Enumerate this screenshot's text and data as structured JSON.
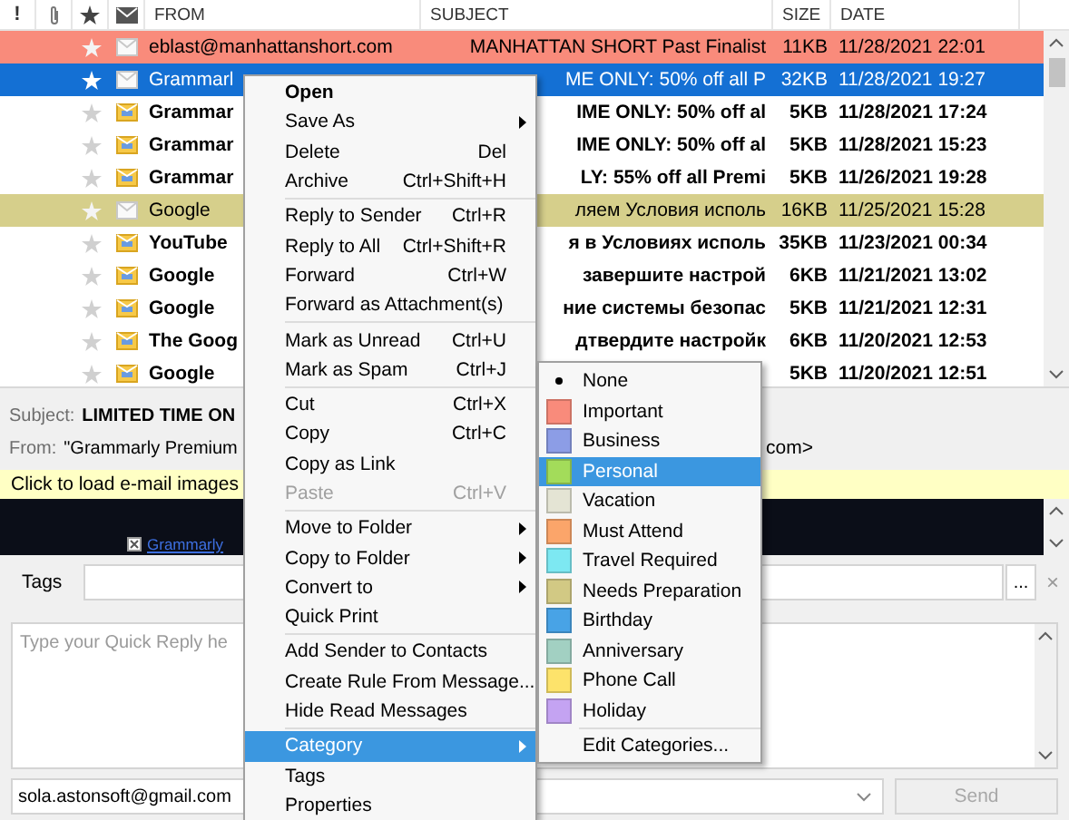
{
  "mail_list": {
    "priority_label": "!",
    "columns": [
      "FROM",
      "SUBJECT",
      "SIZE",
      "DATE"
    ],
    "rows": [
      {
        "from": "eblast@manhattanshort.com",
        "subject": "MANHATTAN SHORT Past Finalist",
        "size": "11KB",
        "date": "11/28/2021 22:01",
        "unread": false,
        "selected": false,
        "color": "#f98b7b"
      },
      {
        "from": "Grammarl",
        "subject": "ME ONLY: 50% off all P",
        "size": "32KB",
        "date": "11/28/2021 19:27",
        "unread": false,
        "selected": true
      },
      {
        "from": "Grammar",
        "subject": "IME ONLY: 50% off al",
        "size": "5KB",
        "date": "11/28/2021 17:24",
        "unread": true,
        "selected": false
      },
      {
        "from": "Grammar",
        "subject": "IME ONLY: 50% off al",
        "size": "5KB",
        "date": "11/28/2021 15:23",
        "unread": true,
        "selected": false
      },
      {
        "from": "Grammar",
        "subject": "LY: 55% off all Premi",
        "size": "5KB",
        "date": "11/26/2021 19:28",
        "unread": true,
        "selected": false
      },
      {
        "from": "Google",
        "subject": "ляем Условия исполь",
        "size": "16KB",
        "date": "11/25/2021 15:28",
        "unread": false,
        "selected": false,
        "color": "#d6cf8b"
      },
      {
        "from": "YouTube",
        "subject": "я в Условиях исполь",
        "size": "35KB",
        "date": "11/23/2021 00:34",
        "unread": true,
        "selected": false
      },
      {
        "from": "Google",
        "subject": "завершите настрой",
        "size": "6KB",
        "date": "11/21/2021 13:02",
        "unread": true,
        "selected": false
      },
      {
        "from": "Google",
        "subject": "ние системы безопас",
        "size": "5KB",
        "date": "11/21/2021 12:31",
        "unread": true,
        "selected": false
      },
      {
        "from": "The Goog",
        "subject": "дтвердите настройк",
        "size": "6KB",
        "date": "11/20/2021 12:53",
        "unread": true,
        "selected": false
      },
      {
        "from": "Google",
        "size": "5KB",
        "date": "11/20/2021 12:51",
        "unread": true,
        "selected": false
      }
    ]
  },
  "preview": {
    "subject_label": "Subject:",
    "subject": "LIMITED TIME ON",
    "from_label": "From:",
    "from": "\"Grammarly Premium",
    "from_end": "com>",
    "notice": "Click to load e-mail images",
    "image_link": "Grammarly",
    "tags_label": "Tags",
    "tags_button": "...",
    "tags_clear": "×",
    "quick_reply_placeholder": "Type your Quick Reply he",
    "account": "sola.astonsoft@gmail.com",
    "send": {
      "label": "Send",
      "disabled": true
    }
  },
  "context_menu": {
    "items": [
      {
        "kind": "item",
        "label": "Open",
        "default": true,
        "submenu": false,
        "disabled": false,
        "selected": false
      },
      {
        "kind": "item",
        "label": "Save As",
        "default": false,
        "submenu": true,
        "disabled": false,
        "selected": false
      },
      {
        "kind": "item",
        "label": "Delete",
        "shortcut": "Del",
        "default": false,
        "submenu": false,
        "disabled": false,
        "selected": false
      },
      {
        "kind": "item",
        "label": "Archive",
        "shortcut": "Ctrl+Shift+H",
        "default": false,
        "submenu": false,
        "disabled": false,
        "selected": false
      },
      {
        "kind": "separator"
      },
      {
        "kind": "item",
        "label": "Reply to Sender",
        "shortcut": "Ctrl+R",
        "default": false,
        "submenu": false,
        "disabled": false,
        "selected": false
      },
      {
        "kind": "item",
        "label": "Reply to All",
        "shortcut": "Ctrl+Shift+R",
        "default": false,
        "submenu": false,
        "disabled": false,
        "selected": false
      },
      {
        "kind": "item",
        "label": "Forward",
        "shortcut": "Ctrl+W",
        "default": false,
        "submenu": false,
        "disabled": false,
        "selected": false
      },
      {
        "kind": "item",
        "label": "Forward as Attachment(s)",
        "default": false,
        "submenu": false,
        "disabled": false,
        "selected": false
      },
      {
        "kind": "separator"
      },
      {
        "kind": "item",
        "label": "Mark as Unread",
        "shortcut": "Ctrl+U",
        "default": false,
        "submenu": false,
        "disabled": false,
        "selected": false
      },
      {
        "kind": "item",
        "label": "Mark as Spam",
        "shortcut": "Ctrl+J",
        "default": false,
        "submenu": false,
        "disabled": false,
        "selected": false
      },
      {
        "kind": "separator"
      },
      {
        "kind": "item",
        "label": "Cut",
        "shortcut": "Ctrl+X",
        "default": false,
        "submenu": false,
        "disabled": false,
        "selected": false
      },
      {
        "kind": "item",
        "label": "Copy",
        "shortcut": "Ctrl+C",
        "default": false,
        "submenu": false,
        "disabled": false,
        "selected": false
      },
      {
        "kind": "item",
        "label": "Copy as Link",
        "default": false,
        "submenu": false,
        "disabled": false,
        "selected": false
      },
      {
        "kind": "item",
        "label": "Paste",
        "shortcut": "Ctrl+V",
        "default": false,
        "submenu": false,
        "disabled": true,
        "selected": false
      },
      {
        "kind": "separator"
      },
      {
        "kind": "item",
        "label": "Move to Folder",
        "default": false,
        "submenu": true,
        "disabled": false,
        "selected": false
      },
      {
        "kind": "item",
        "label": "Copy to Folder",
        "default": false,
        "submenu": true,
        "disabled": false,
        "selected": false
      },
      {
        "kind": "item",
        "label": "Convert to",
        "default": false,
        "submenu": true,
        "disabled": false,
        "selected": false
      },
      {
        "kind": "item",
        "label": "Quick Print",
        "default": false,
        "submenu": false,
        "disabled": false,
        "selected": false
      },
      {
        "kind": "separator"
      },
      {
        "kind": "item",
        "label": "Add Sender to Contacts",
        "default": false,
        "submenu": false,
        "disabled": false,
        "selected": false
      },
      {
        "kind": "item",
        "label": "Create Rule From Message...",
        "default": false,
        "submenu": false,
        "disabled": false,
        "selected": false
      },
      {
        "kind": "item",
        "label": "Hide Read Messages",
        "default": false,
        "submenu": false,
        "disabled": false,
        "selected": false
      },
      {
        "kind": "separator"
      },
      {
        "kind": "item",
        "label": "Category",
        "default": false,
        "submenu": true,
        "disabled": false,
        "selected": true
      },
      {
        "kind": "item",
        "label": "Tags",
        "default": false,
        "submenu": false,
        "disabled": false,
        "selected": false
      },
      {
        "kind": "item",
        "label": "Properties",
        "default": false,
        "submenu": false,
        "disabled": false,
        "selected": false
      }
    ]
  },
  "category_menu": {
    "items": [
      {
        "kind": "item",
        "label": "None",
        "checked": true,
        "selected": false
      },
      {
        "kind": "item",
        "label": "Important",
        "color": "#f98b7b",
        "checked": false,
        "selected": false
      },
      {
        "kind": "item",
        "label": "Business",
        "color": "#8c9de6",
        "checked": false,
        "selected": false
      },
      {
        "kind": "item",
        "label": "Personal",
        "color": "#a3dc5a",
        "checked": false,
        "selected": true
      },
      {
        "kind": "item",
        "label": "Vacation",
        "color": "#e4e4d4",
        "checked": false,
        "selected": false
      },
      {
        "kind": "item",
        "label": "Must Attend",
        "color": "#fba56a",
        "checked": false,
        "selected": false
      },
      {
        "kind": "item",
        "label": "Travel Required",
        "color": "#7de8f2",
        "checked": false,
        "selected": false
      },
      {
        "kind": "item",
        "label": "Needs Preparation",
        "color": "#d2c984",
        "checked": false,
        "selected": false
      },
      {
        "kind": "item",
        "label": "Birthday",
        "color": "#48a3e6",
        "checked": false,
        "selected": false
      },
      {
        "kind": "item",
        "label": "Anniversary",
        "color": "#a2d0c2",
        "checked": false,
        "selected": false
      },
      {
        "kind": "item",
        "label": "Phone Call",
        "color": "#fde36b",
        "checked": false,
        "selected": false
      },
      {
        "kind": "item",
        "label": "Holiday",
        "color": "#c4a3f2",
        "checked": false,
        "selected": false
      },
      {
        "kind": "separator"
      },
      {
        "kind": "item",
        "label": "Edit Categories...",
        "checked": false,
        "selected": false
      }
    ]
  }
}
